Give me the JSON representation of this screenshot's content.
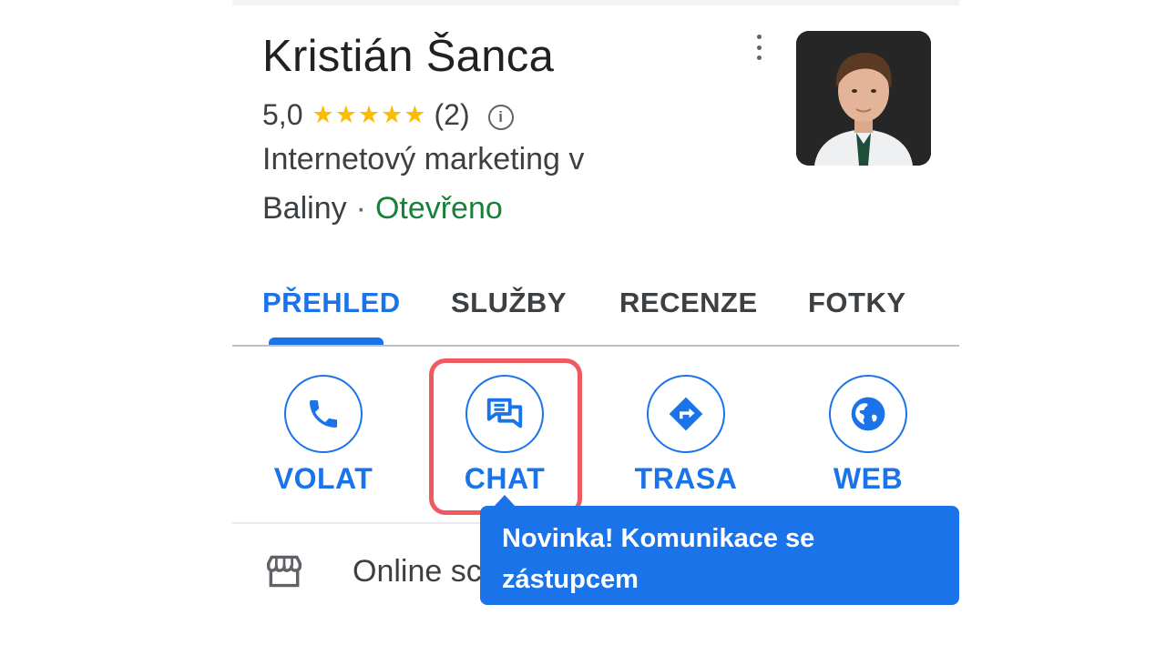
{
  "business": {
    "name": "Kristián Šanca",
    "rating": "5,0",
    "stars": "★★★★★",
    "review_count": "(2)",
    "category_line1": "Internetový marketing v",
    "location": "Baliny",
    "separator": "·",
    "status": "Otevřeno"
  },
  "tabs": [
    {
      "label": "PŘEHLED",
      "active": true
    },
    {
      "label": "SLUŽBY",
      "active": false
    },
    {
      "label": "RECENZE",
      "active": false
    },
    {
      "label": "FOTKY",
      "active": false
    }
  ],
  "actions": [
    {
      "label": "VOLAT",
      "icon": "phone-icon"
    },
    {
      "label": "CHAT",
      "icon": "chat-icon"
    },
    {
      "label": "TRASA",
      "icon": "directions-icon"
    },
    {
      "label": "WEB",
      "icon": "globe-icon"
    }
  ],
  "store_row": {
    "icon": "storefront-icon",
    "label": "Online sc"
  },
  "tooltip": {
    "line1": "Novinka! Komunikace se",
    "line2": "zástupcem"
  },
  "colors": {
    "accent": "#1a73e8",
    "open_status": "#188038",
    "stars": "#fbbc04",
    "highlight": "#ee5a60"
  }
}
